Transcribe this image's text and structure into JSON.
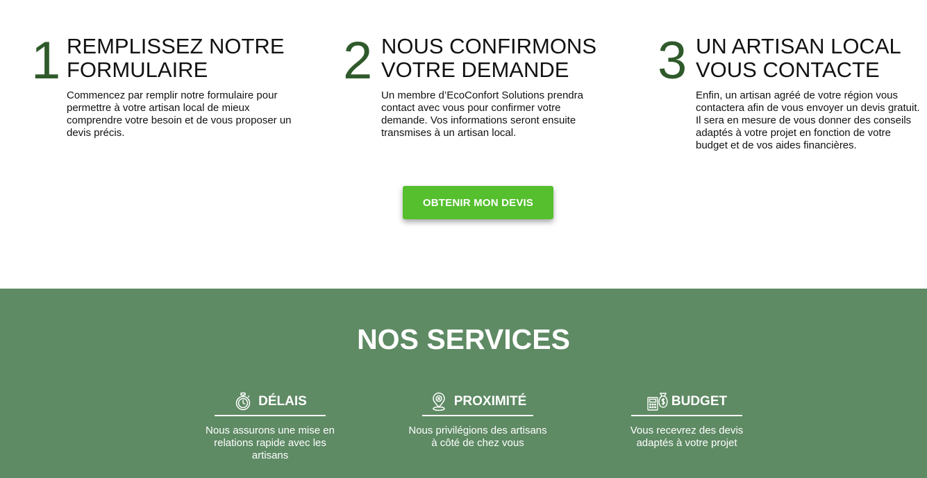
{
  "steps": [
    {
      "number": "1",
      "title_line1": "REMPLISSEZ NOTRE",
      "title_line2": "FORMULAIRE",
      "text": "Commencez par remplir notre formulaire pour permettre à votre artisan local de mieux comprendre votre besoin et de vous proposer un devis précis."
    },
    {
      "number": "2",
      "title_line1": "NOUS CONFIRMONS",
      "title_line2": "VOTRE DEMANDE",
      "text": "Un membre d’EcoConfort Solutions prendra contact avec vous pour confirmer votre demande. Vos informations seront ensuite transmises à un artisan local."
    },
    {
      "number": "3",
      "title_line1": "UN ARTISAN LOCAL",
      "title_line2": "VOUS CONTACTE",
      "text": "Enfin, un artisan agréé de votre région vous contactera afin de vous envoyer un devis gratuit. Il sera en mesure de vous donner des conseils adaptés à votre projet en fonction de votre budget et de vos aides financières."
    }
  ],
  "cta": {
    "label": "OBTENIR MON DEVIS"
  },
  "services": {
    "title": "NOS SERVICES",
    "items": [
      {
        "icon": "stopwatch-icon",
        "label": "DÉLAIS",
        "text": "Nous assurons une mise en relations rapide avec les artisans"
      },
      {
        "icon": "location-pin-icon",
        "label": "PROXIMITÉ",
        "text": "Nous privilégions des artisans à côté de chez vous"
      },
      {
        "icon": "calculator-money-icon",
        "label": "BUDGET",
        "text": "Vous recevrez des devis adaptés à votre projet"
      }
    ]
  },
  "colors": {
    "step_number": "#2f5a2b",
    "cta_background": "#55bf2e",
    "services_background": "#5e8a64"
  }
}
